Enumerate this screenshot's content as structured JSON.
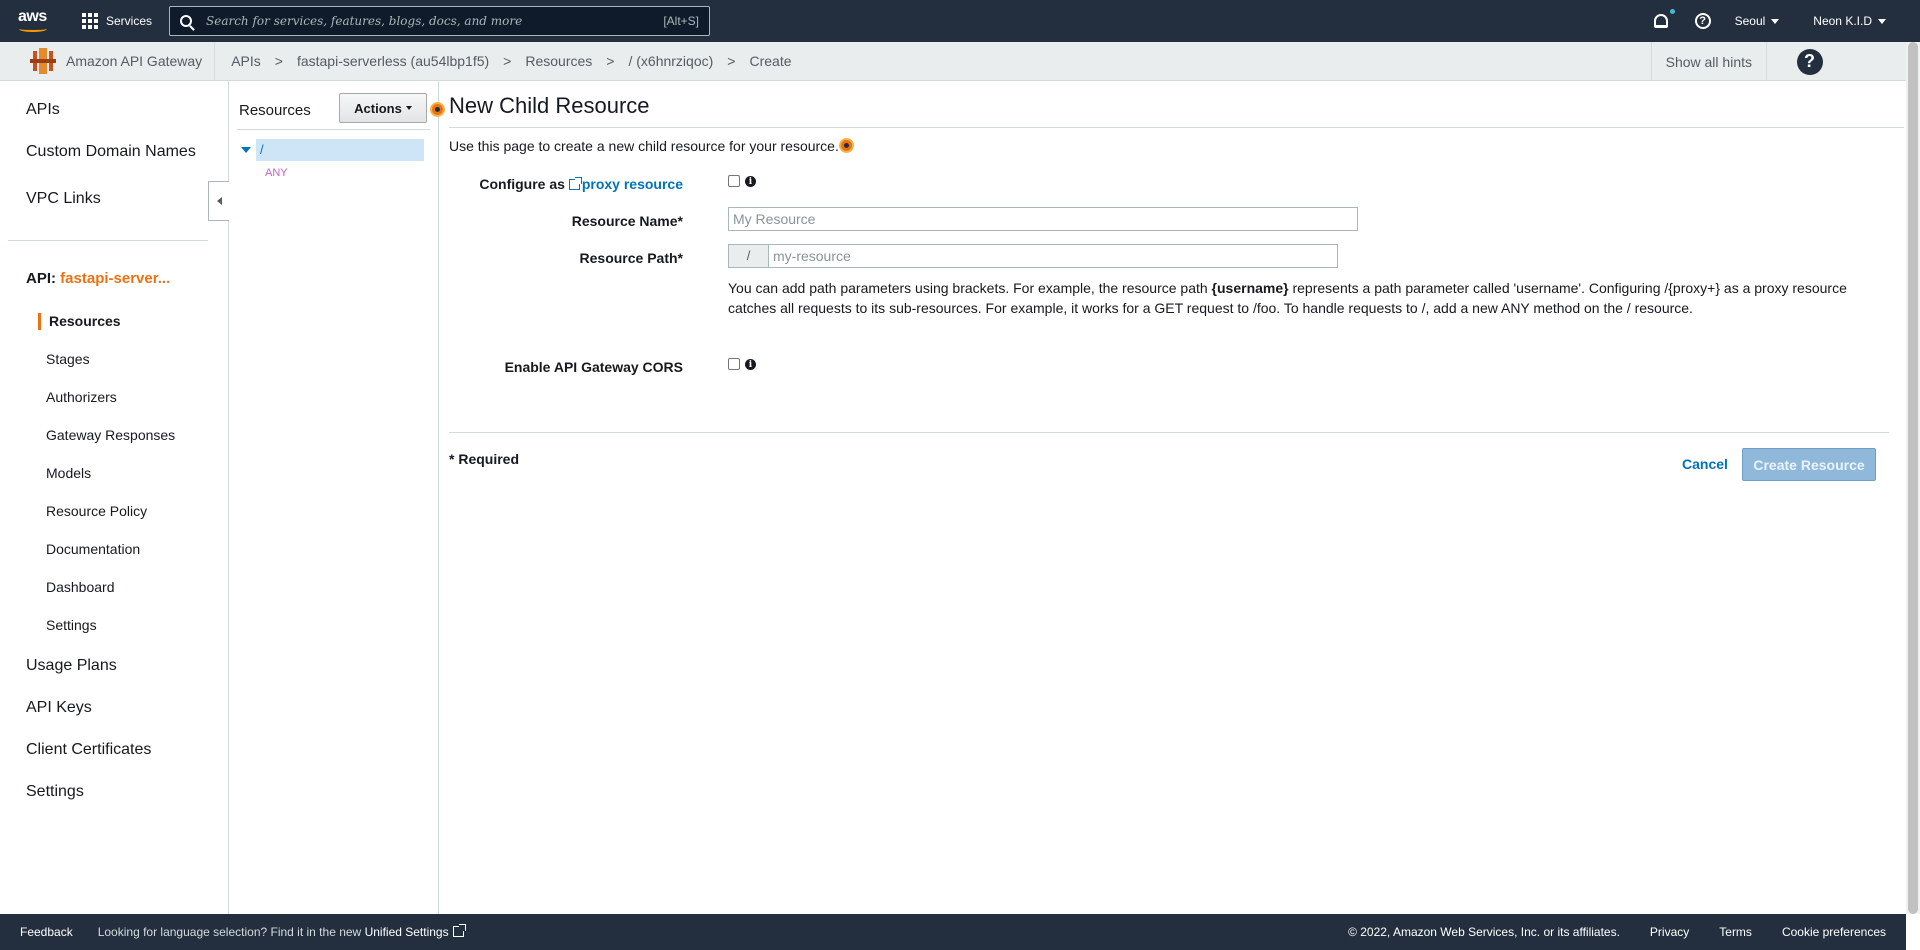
{
  "topnav": {
    "logo_text": "aws",
    "services_label": "Services",
    "search_placeholder": "Search for services, features, blogs, docs, and more",
    "search_shortcut": "[Alt+S]",
    "region": "Seoul",
    "user": "Neon K.I.D",
    "help_glyph": "?"
  },
  "crumbbar": {
    "service_name": "Amazon API Gateway",
    "crumbs": [
      "APIs",
      "fastapi-serverless (au54lbp1f5)",
      "Resources",
      "/ (x6hnrziqoc)",
      "Create"
    ],
    "separator": ">",
    "show_hints": "Show all hints",
    "help_glyph": "?"
  },
  "leftnav": {
    "top_items": [
      "APIs",
      "Custom Domain Names",
      "VPC Links"
    ],
    "api_prefix": "API:",
    "api_name": "fastapi-server...",
    "sub_items": [
      "Resources",
      "Stages",
      "Authorizers",
      "Gateway Responses",
      "Models",
      "Resource Policy",
      "Documentation",
      "Dashboard",
      "Settings"
    ],
    "bottom_items": [
      "Usage Plans",
      "API Keys",
      "Client Certificates",
      "Settings"
    ]
  },
  "resources_panel": {
    "title": "Resources",
    "actions_label": "Actions",
    "root_path": "/",
    "root_method": "ANY"
  },
  "main": {
    "title": "New Child Resource",
    "intro": "Use this page to create a new child resource for your resource.",
    "configure_prefix": "Configure as",
    "proxy_link": "proxy resource",
    "resource_name_label": "Resource Name*",
    "resource_name_placeholder": "My Resource",
    "resource_path_label": "Resource Path*",
    "resource_path_prefix": "/",
    "resource_path_placeholder": "my-resource",
    "help_1": "You can add path parameters using brackets. For example, the resource path",
    "help_bold": "{username}",
    "help_2": "represents a path parameter called 'username'. Configuring /{proxy+} as a proxy resource catches all requests to its sub-resources. For example, it works for a GET request to /foo. To handle requests to /, add a new ANY method on the / resource.",
    "cors_label": "Enable API Gateway CORS",
    "info_glyph": "i",
    "required_note": "* Required",
    "cancel_label": "Cancel",
    "create_label": "Create Resource"
  },
  "footer": {
    "feedback": "Feedback",
    "lang_text": "Looking for language selection? Find it in the new",
    "lang_link": "Unified Settings",
    "copyright": "© 2022, Amazon Web Services, Inc. or its affiliates.",
    "links": [
      "Privacy",
      "Terms",
      "Cookie preferences"
    ]
  },
  "colors": {
    "nav_bg": "#232f3e",
    "accent_orange": "#ec7211",
    "link_blue": "#0073bb",
    "primary_disabled": "#8fb8db"
  }
}
